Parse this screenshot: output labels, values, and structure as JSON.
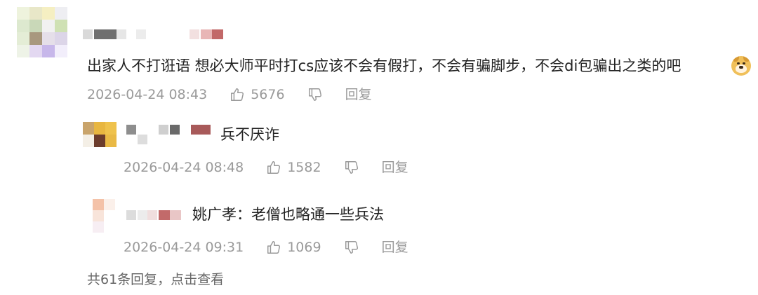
{
  "comment": {
    "text": "出家人不打诳语 想必大师平时打cs应该不会有假打，不会有骗脚步，不会di包骗出之类的吧",
    "emoji_icon": "doge-emoji-icon",
    "timestamp": "2026-04-24 08:43",
    "like_count": "5676",
    "reply_label": "回复"
  },
  "replies": [
    {
      "text": "兵不厌诈",
      "timestamp": "2026-04-24 08:48",
      "like_count": "1582",
      "reply_label": "回复"
    },
    {
      "text": "姚广孝：老僧也略通一些兵法",
      "timestamp": "2026-04-24 09:31",
      "like_count": "1069",
      "reply_label": "回复"
    }
  ],
  "more_replies_label": "共61条回复，点击查看",
  "icons": {
    "like": "thumbs-up-icon",
    "dislike": "thumbs-down-icon"
  },
  "colors": {
    "text": "#222222",
    "meta": "#9a9a9a",
    "more": "#666666"
  }
}
